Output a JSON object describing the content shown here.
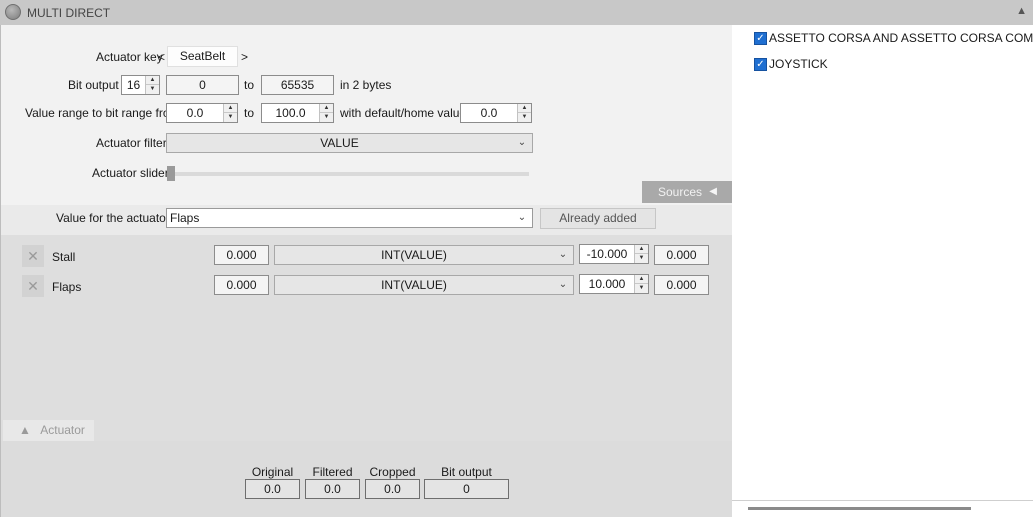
{
  "window": {
    "title": "MULTI DIRECT",
    "collapse_icon": "triangle-up-icon"
  },
  "config": {
    "actuator_key": {
      "label": "Actuator key",
      "prev": "<",
      "value": "SeatBelt",
      "next": ">"
    },
    "bit_output": {
      "label": "Bit output",
      "bits": "16",
      "min": "0",
      "to": "to",
      "max": "65535",
      "suffix": "in 2 bytes"
    },
    "value_range": {
      "label": "Value range to bit range from",
      "from": "0.0",
      "to_label": "to",
      "to": "100.0",
      "default_label": "with default/home value",
      "default": "0.0"
    },
    "actuator_filter": {
      "label": "Actuator filter",
      "value": "VALUE"
    },
    "actuator_slider": {
      "label": "Actuator slider",
      "level": 0
    }
  },
  "sources_tab": {
    "label": "Sources",
    "icon": "triangle-left-icon"
  },
  "value_for_actuator": {
    "label": "Value for the actuator",
    "value": "Flaps",
    "button": "Already added"
  },
  "sources": [
    {
      "name": "Stall",
      "current": "0.000",
      "formula": "INT(VALUE)",
      "factor": "-10.000",
      "result": "0.000"
    },
    {
      "name": "Flaps",
      "current": "0.000",
      "formula": "INT(VALUE)",
      "factor": "10.000",
      "result": "0.000"
    }
  ],
  "actuator_tab": {
    "label": "Actuator",
    "icon": "triangle-up-icon"
  },
  "output": {
    "headers": [
      "Original",
      "Filtered",
      "Cropped",
      "Bit output"
    ],
    "values": [
      "0.0",
      "0.0",
      "0.0",
      "0"
    ]
  },
  "games": [
    {
      "label": "ASSETTO CORSA AND ASSETTO CORSA COMPETIZIONE",
      "checked": true
    },
    {
      "label": "JOYSTICK",
      "checked": true
    }
  ],
  "colors": {
    "checkbox": "#1f6fd1",
    "tab_bg": "#a9a9a9"
  }
}
